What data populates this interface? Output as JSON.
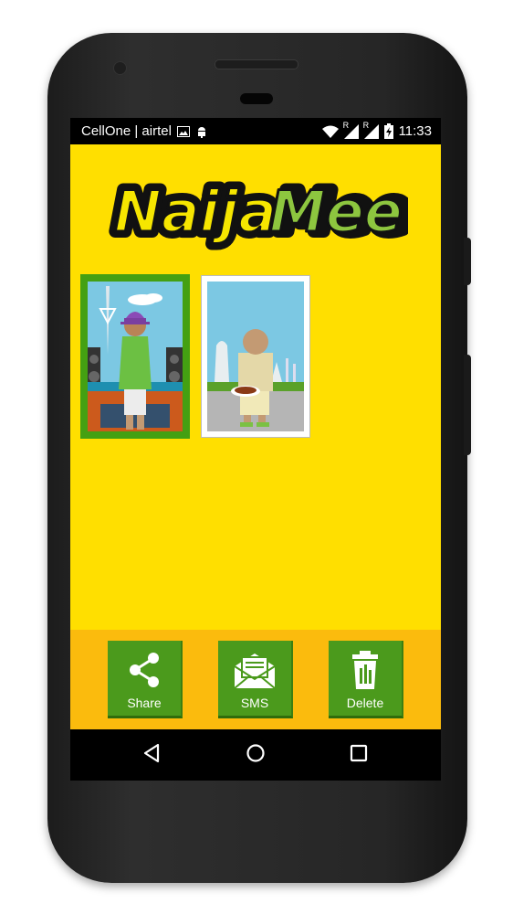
{
  "status_bar": {
    "carrier": "CellOne | airtel",
    "time": "11:33",
    "roaming_label": "R",
    "roaming_label_2": "R"
  },
  "app": {
    "logo_text_part1": "Naija",
    "logo_text_part2": "Mee",
    "colors": {
      "background": "#ffdf00",
      "action_bar": "#fbbb0d",
      "button_green": "#4b9a1c",
      "logo_black": "#111111",
      "logo_yellow": "#f6e600",
      "logo_green": "#8dc63f"
    }
  },
  "gallery": {
    "items": [
      {
        "name": "avatar-dj",
        "selected": true
      },
      {
        "name": "avatar-plate",
        "selected": false
      }
    ]
  },
  "actions": {
    "share_label": "Share",
    "sms_label": "SMS",
    "delete_label": "Delete"
  },
  "nav": {
    "icons": [
      "back-icon",
      "home-icon",
      "recents-icon"
    ]
  }
}
